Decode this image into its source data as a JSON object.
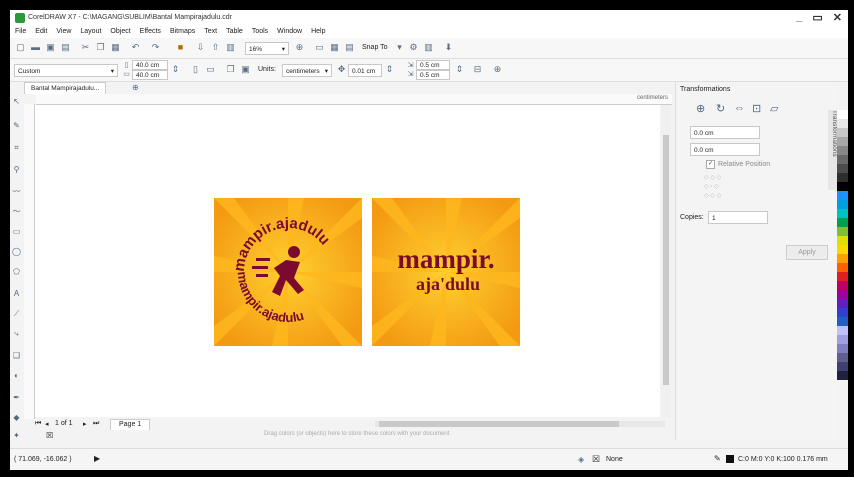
{
  "window": {
    "title": "CorelDRAW X7 - C:\\MAGANG\\SUBLIM\\Bantal Mampirajadulu.cdr",
    "controls": [
      "_",
      "▭",
      "✕"
    ]
  },
  "menu": [
    "File",
    "Edit",
    "View",
    "Layout",
    "Object",
    "Effects",
    "Bitmaps",
    "Text",
    "Table",
    "Tools",
    "Window",
    "Help"
  ],
  "toolbar": {
    "zoom": "16%",
    "snap_to": "Snap To"
  },
  "property_bar": {
    "preset": "Custom",
    "width": "40.0 cm",
    "height": "40.0 cm",
    "units_label": "Units:",
    "units": "centimeters",
    "nudge": "0.01 cm",
    "dup_x": "0.5 cm",
    "dup_y": "0.5 cm"
  },
  "document_tab": "Bantal Mampirajadulu...",
  "ruler": {
    "unit": "centimeters"
  },
  "pages": {
    "count": "1 of 1",
    "current": "Page 1"
  },
  "color_hint": "Drag colors (or objects) here to store these colors with your document",
  "docker": {
    "title": "Transformations",
    "tab_label": "Transformations",
    "x": "0.0 cm",
    "y": "0.0 cm",
    "relative_position": "Relative Position",
    "copies_label": "Copies:",
    "copies": "1",
    "apply": "Apply"
  },
  "status": {
    "coords": "( 71.069, -16.062 )",
    "fill": "None",
    "outline": "C:0 M:0 Y:0 K:100  0.176 mm"
  },
  "artwork": {
    "left_text_top": "mampir.ajadulu",
    "left_text_bottom": "mampir.ajadulu",
    "right_line1": "mampir.",
    "right_line2": "aja'dulu"
  },
  "colors": {
    "orange": "#f7a21c",
    "yellow": "#ffc629",
    "maroon": "#7a0a2e"
  },
  "palette": [
    "#ffffff",
    "#e8e8e8",
    "#c8c8c8",
    "#a8a8a8",
    "#888888",
    "#6a6a6a",
    "#4c4c4c",
    "#2e2e2e",
    "#000000",
    "#1e90ff",
    "#00a0e0",
    "#00c0c0",
    "#00a050",
    "#80c030",
    "#e0e000",
    "#ffd800",
    "#ffa000",
    "#ff6000",
    "#e02020",
    "#c00060",
    "#a000a0",
    "#6020c0",
    "#3040d0",
    "#2060c0",
    "#c0c0ff",
    "#a0a0e0",
    "#8080c0",
    "#606090",
    "#404070",
    "#202040"
  ]
}
